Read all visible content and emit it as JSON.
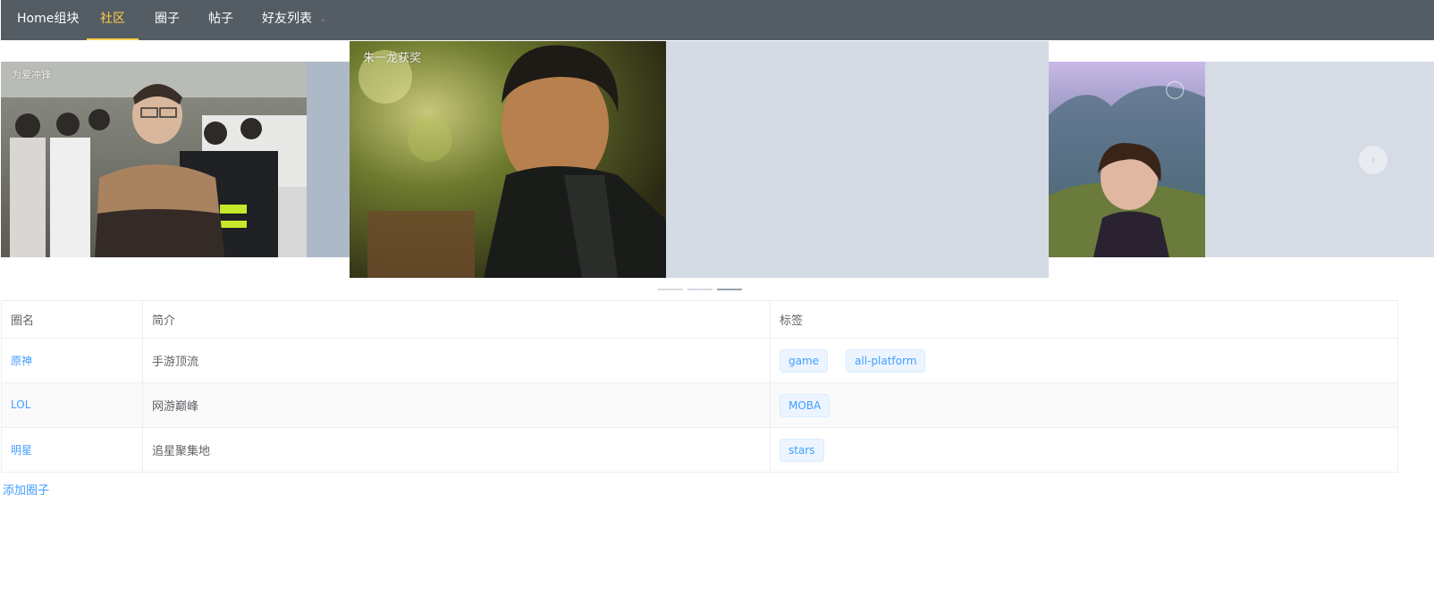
{
  "nav": {
    "items": [
      {
        "label": "Home组块",
        "active": false
      },
      {
        "label": "社区",
        "active": true
      },
      {
        "label": "圈子",
        "active": false
      },
      {
        "label": "帖子",
        "active": false
      },
      {
        "label": "好友列表",
        "active": false,
        "has_dropdown": true
      }
    ],
    "background": "#545c64",
    "active_color": "#ffd04b"
  },
  "carousel": {
    "slides": [
      {
        "caption": "为爱冲锋",
        "position": "left"
      },
      {
        "caption": "朱一龙获奖",
        "position": "center"
      },
      {
        "caption": "",
        "position": "right",
        "watermark": "weibo-logo-icon"
      }
    ],
    "active_index": 2,
    "indicator_count": 3,
    "next_icon": "chevron-right-icon"
  },
  "table": {
    "headers": [
      "圈名",
      "简介",
      "标签"
    ],
    "rows": [
      {
        "name": "原神",
        "intro": "手游顶流",
        "tags": [
          "game",
          "all-platform"
        ]
      },
      {
        "name": "LOL",
        "intro": "网游巅峰",
        "tags": [
          "MOBA"
        ]
      },
      {
        "name": "明星",
        "intro": "追星聚集地",
        "tags": [
          "stars"
        ]
      }
    ]
  },
  "add_circle_label": "添加圈子",
  "colors": {
    "link": "#409eff",
    "tag_bg": "#ecf5ff",
    "tag_border": "#d9ecff"
  }
}
